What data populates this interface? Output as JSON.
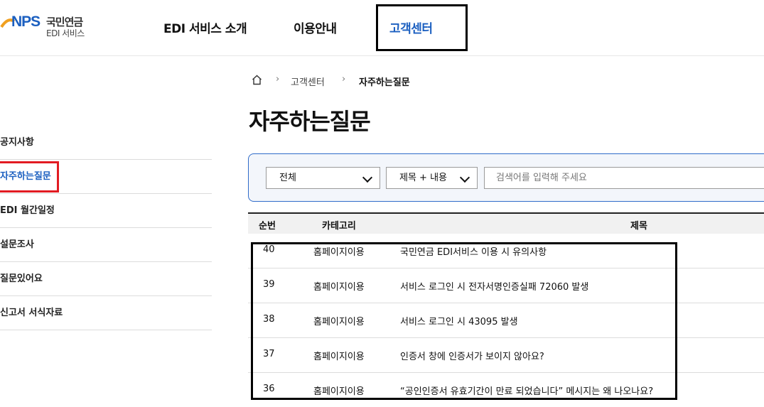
{
  "logo": {
    "nps": "NPS",
    "korean": "국민연금",
    "sub": "EDI 서비스"
  },
  "nav": {
    "items": [
      "EDI 서비스 소개",
      "이용안내",
      "고객센터"
    ],
    "active_index": 2
  },
  "sidebar": {
    "items": [
      "공지사항",
      "자주하는질문",
      "EDI 월간일정",
      "설문조사",
      "질문있어요",
      "신고서 서식자료"
    ],
    "active_index": 1
  },
  "breadcrumb": [
    "고객센터",
    "자주하는질문"
  ],
  "page_title": "자주하는질문",
  "search": {
    "category_value": "전체",
    "field_value": "제목 + 내용",
    "placeholder": "검색어를 입력해 주세요"
  },
  "table": {
    "headers": [
      "순번",
      "카테고리",
      "제목"
    ],
    "rows": [
      {
        "no": "40",
        "category": "홈페이지이용",
        "title": "국민연금 EDI서비스 이용 시 유의사항"
      },
      {
        "no": "39",
        "category": "홈페이지이용",
        "title": "서비스 로그인 시 전자서명인증실패 72060 발생"
      },
      {
        "no": "38",
        "category": "홈페이지이용",
        "title": "서비스 로그인 시 43095 발생"
      },
      {
        "no": "37",
        "category": "홈페이지이용",
        "title": "인증서 창에 인증서가 보이지 않아요?"
      },
      {
        "no": "36",
        "category": "홈페이지이용",
        "title": "“공인인증서 유효기간이 만료 되었습니다” 메시지는 왜 나오나요?"
      }
    ]
  },
  "colors": {
    "accent": "#1b5fc0",
    "highlight_red": "#e21b22"
  },
  "icons": {
    "home": "home-icon",
    "chevron": "chevron-down-icon",
    "separator": "chevron-right-icon"
  }
}
